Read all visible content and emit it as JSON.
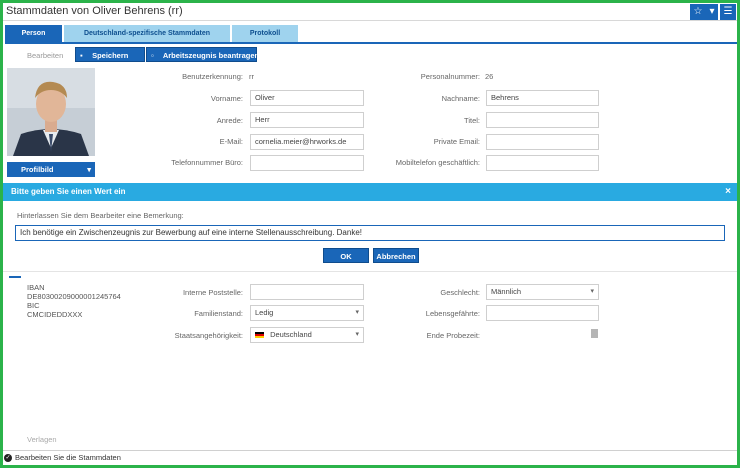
{
  "window": {
    "title": "Stammdaten von Oliver Behrens (rr)",
    "star_icon": "☆",
    "caret": "▾",
    "menu_icon": "☰"
  },
  "tabs": [
    {
      "label": "Person",
      "active": true
    },
    {
      "label": "Deutschland-spezifische Stammdaten",
      "active": false
    },
    {
      "label": "Protokoll",
      "active": false
    }
  ],
  "actions": {
    "edit_label": "Bearbeiten",
    "save_label": "Speichern",
    "certificate_label": "Arbeitszeugnis beantragen"
  },
  "profile": {
    "button_label": "Profilbild"
  },
  "fields": {
    "username_label": "Benutzerkennung:",
    "username_value": "rr",
    "personnel_label": "Personalnummer:",
    "personnel_value": "26",
    "firstname_label": "Vorname:",
    "firstname_value": "Oliver",
    "lastname_label": "Nachname:",
    "lastname_value": "Behrens",
    "salutation_label": "Anrede:",
    "salutation_value": "Herr",
    "title_label": "Titel:",
    "title_value": "",
    "email_label": "E-Mail:",
    "email_value": "cornelia.meier@hrworks.de",
    "private_email_label": "Private Email:",
    "private_email_value": "",
    "phone_label": "Telefonnummer Büro:",
    "phone_value": "",
    "mobile_label": "Mobiltelefon geschäftlich:",
    "mobile_value": ""
  },
  "dialog": {
    "title": "Bitte geben Sie einen Wert ein",
    "close_icon": "×",
    "prompt": "Hinterlassen Sie dem Bearbeiter eine Bemerkung:",
    "input_value": "Ich benötige ein Zwischenzeugnis zur Bewerbung auf eine interne Stellenausschreibung. Danke!",
    "ok_label": "OK",
    "cancel_label": "Abbrechen"
  },
  "bank": {
    "iban_label": "IBAN",
    "iban_value": "DE80300209000001245764",
    "bic_label": "BIC",
    "bic_value": "CMCIDEDDXXX"
  },
  "lower_fields": {
    "post_label": "Interne Poststelle:",
    "post_value": "",
    "gender_label": "Geschlecht:",
    "gender_value": "Männlich",
    "marital_label": "Familienstand:",
    "marital_value": "Ledig",
    "partner_label": "Lebensgefährte:",
    "partner_value": "",
    "nationality_label": "Staatsangehörigkeit:",
    "nationality_value": "Deutschland",
    "probation_label": "Ende Probezeit:",
    "probation_value": ""
  },
  "footer": {
    "link_label": "Verlagen",
    "status_text": "Bearbeiten Sie die Stammdaten"
  }
}
